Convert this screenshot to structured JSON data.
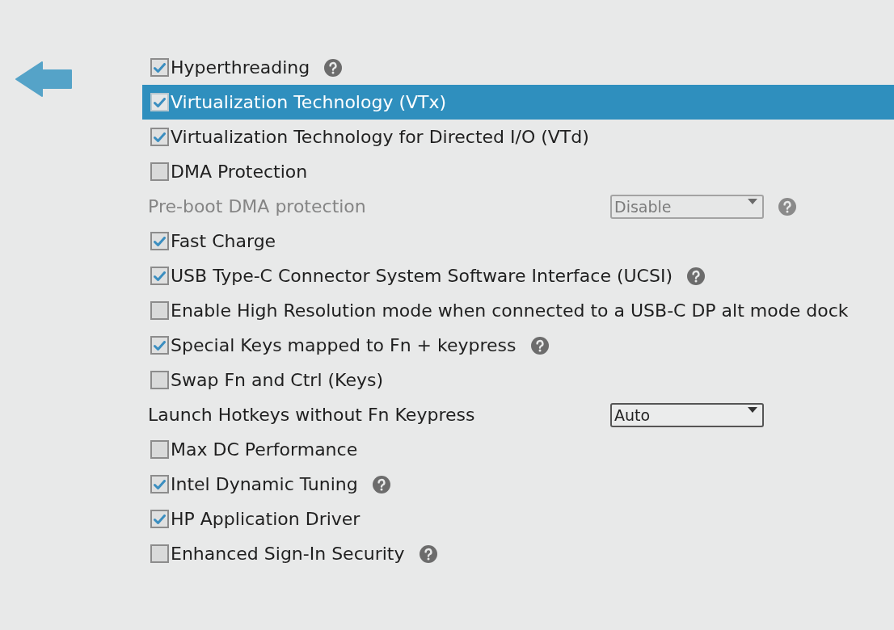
{
  "settings": [
    {
      "kind": "checkbox",
      "label": "Hyperthreading",
      "checked": true,
      "selected": false,
      "help": true
    },
    {
      "kind": "checkbox",
      "label": "Virtualization Technology (VTx)",
      "checked": true,
      "selected": true,
      "help": false
    },
    {
      "kind": "checkbox",
      "label": "Virtualization Technology for Directed I/O (VTd)",
      "checked": true,
      "selected": false,
      "help": false
    },
    {
      "kind": "checkbox",
      "label": "DMA Protection",
      "checked": false,
      "selected": false,
      "help": false
    },
    {
      "kind": "select",
      "label": "Pre-boot DMA protection",
      "value": "Disable",
      "selected": false,
      "disabled": true,
      "help": true
    },
    {
      "kind": "checkbox",
      "label": "Fast Charge",
      "checked": true,
      "selected": false,
      "help": false
    },
    {
      "kind": "checkbox",
      "label": "USB Type-C Connector System Software Interface (UCSI)",
      "checked": true,
      "selected": false,
      "help": true
    },
    {
      "kind": "checkbox",
      "label": "Enable High Resolution mode when connected to a USB-C DP alt mode dock",
      "checked": false,
      "selected": false,
      "help": false
    },
    {
      "kind": "checkbox",
      "label": "Special Keys mapped to Fn + keypress",
      "checked": true,
      "selected": false,
      "help": true
    },
    {
      "kind": "checkbox",
      "label": "Swap Fn and Ctrl (Keys)",
      "checked": false,
      "selected": false,
      "help": false
    },
    {
      "kind": "select",
      "label": "Launch Hotkeys without Fn Keypress",
      "value": "Auto",
      "selected": false,
      "disabled": false,
      "help": false
    },
    {
      "kind": "checkbox",
      "label": "Max DC Performance",
      "checked": false,
      "selected": false,
      "help": false
    },
    {
      "kind": "checkbox",
      "label": "Intel Dynamic Tuning",
      "checked": true,
      "selected": false,
      "help": true
    },
    {
      "kind": "checkbox",
      "label": "HP Application Driver",
      "checked": true,
      "selected": false,
      "help": false
    },
    {
      "kind": "checkbox",
      "label": "Enhanced Sign-In Security",
      "checked": false,
      "selected": false,
      "help": true
    }
  ]
}
